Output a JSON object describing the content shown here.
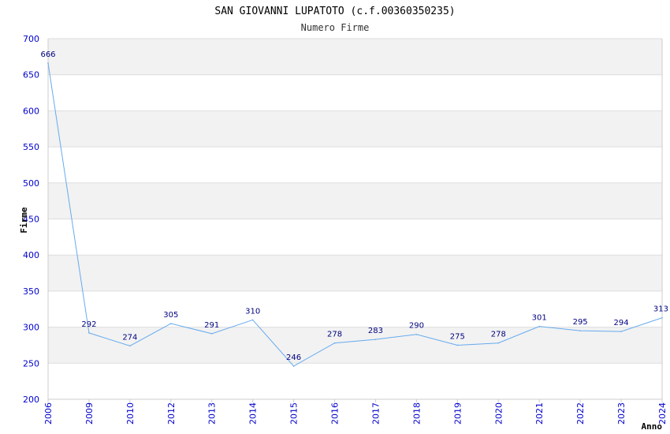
{
  "chart_data": {
    "type": "line",
    "title": "SAN GIOVANNI LUPATOTO (c.f.00360350235)",
    "subtitle": "Numero Firme",
    "xlabel": "Anno",
    "ylabel": "Firme",
    "ylim": [
      200,
      700
    ],
    "yticks": [
      200,
      250,
      300,
      350,
      400,
      450,
      500,
      550,
      600,
      650,
      700
    ],
    "categories": [
      "2006",
      "2009",
      "2010",
      "2012",
      "2013",
      "2014",
      "2015",
      "2016",
      "2017",
      "2018",
      "2019",
      "2020",
      "2021",
      "2022",
      "2023",
      "2024"
    ],
    "values": [
      666,
      292,
      274,
      305,
      291,
      310,
      246,
      278,
      283,
      290,
      275,
      278,
      301,
      295,
      294,
      313
    ],
    "grid": true,
    "colors": {
      "line": "#66aaee",
      "band": "#f2f2f2",
      "grid": "#dddddd",
      "axis": "#cccccc",
      "tick_text": "#0000cc",
      "label_text": "#000080"
    }
  }
}
